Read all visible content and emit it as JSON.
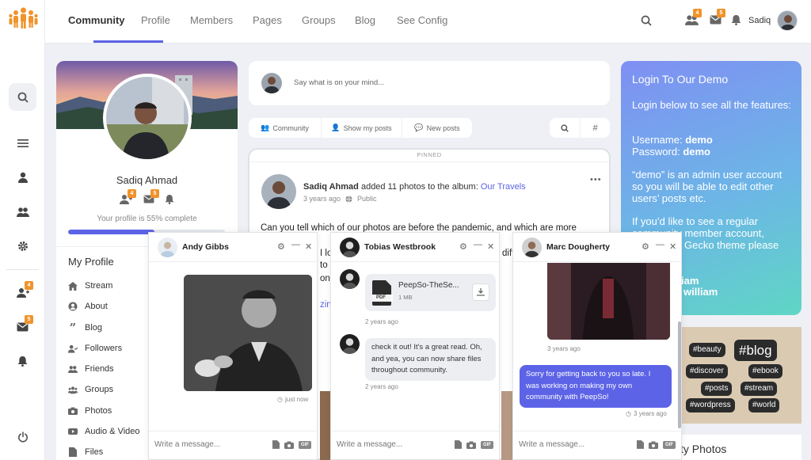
{
  "nav": {
    "tabs": [
      "Community",
      "Profile",
      "Members",
      "Pages",
      "Groups",
      "Blog",
      "See Config"
    ],
    "active": "Community",
    "friends_badge": "4",
    "messages_badge": "5",
    "user_name": "Sadiq"
  },
  "rail": {
    "friends_badge": "4",
    "messages_badge": "5"
  },
  "profile": {
    "name": "Sadiq Ahmad",
    "friends_badge": "4",
    "messages_badge": "5",
    "completion_text": "Your profile is 55% complete",
    "completion": 0.55,
    "menu_title": "My Profile",
    "menu": [
      "Stream",
      "About",
      "Blog",
      "Followers",
      "Friends",
      "Groups",
      "Photos",
      "Audio & Video",
      "Files"
    ]
  },
  "composer": {
    "placeholder": "Say what is on your mind..."
  },
  "filters": {
    "community": "Community",
    "my_posts": "Show my posts",
    "new_posts": "New posts"
  },
  "post": {
    "pinned": "PINNED",
    "author": "Sadiq Ahmad",
    "action": "added 11 photos to the album:",
    "album": "Our Travels",
    "time": "3 years ago",
    "privacy": "Public",
    "text": "Can you tell which of our photos are before the pandemic, and which are more",
    "frag_1": "diff",
    "frag_2": "I lo",
    "frag_3": "to",
    "frag_4": "one",
    "frag_5": "zin"
  },
  "login": {
    "title": "Login To Our Demo",
    "intro": "Login below to see all the features:",
    "username_label": "Username:",
    "username": "demo",
    "password_label": "Password:",
    "password": "demo",
    "note": "“demo” is an admin user account so you will be able to edit other users’ posts etc.",
    "regular": "If you’d like to see a regular",
    "regular2": "community member account,",
    "gecko": "Gecko theme please",
    "frag_iam": "iam",
    "frag_william": "william"
  },
  "tags": [
    "#beauty",
    "#blog",
    "#discover",
    "#ebook",
    "#posts",
    "#stream",
    "#wordpress",
    "#world"
  ],
  "photos_heading_frag": "ty Photos",
  "chats": [
    {
      "name": "Andy Gibbs",
      "time": "just now",
      "placeholder": "Write a message..."
    },
    {
      "name": "Tobias Westbrook",
      "file_name": "PeepSo-TheSe...",
      "file_size": "1 MB",
      "file_type": "PDF",
      "time1": "2 years ago",
      "message": "check it out! It's a great read. Oh, and yea, you can now share files throughout community.",
      "time2": "2 years ago",
      "placeholder": "Write a message..."
    },
    {
      "name": "Marc Dougherty",
      "time1": "3 years ago",
      "message": "Sorry for getting back to you so late. I was working on making my own community with PeepSo!",
      "time2": "3 years ago",
      "placeholder": "Write a message..."
    }
  ],
  "colors": {
    "accent": "#5d63e6",
    "badge": "#f0932b",
    "chat_bubble_own": "#5d63e6"
  }
}
